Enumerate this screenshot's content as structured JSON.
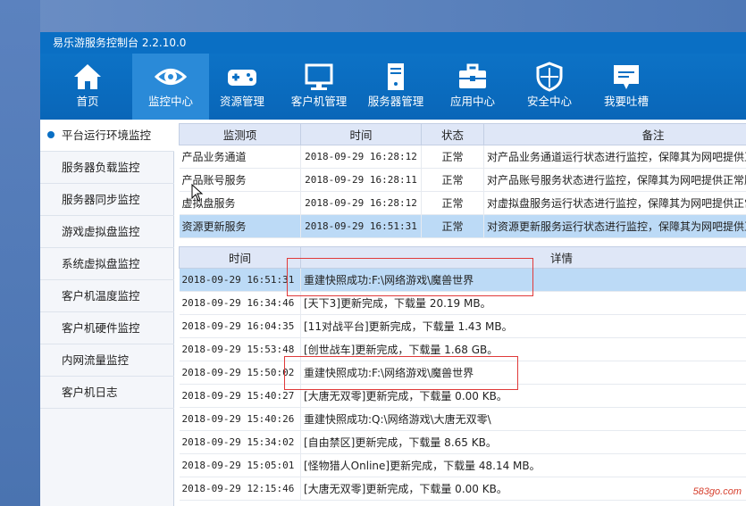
{
  "window": {
    "title": "易乐游服务控制台 2.2.10.0"
  },
  "toolbar": {
    "items": [
      {
        "label": "首页",
        "icon": "home-icon"
      },
      {
        "label": "监控中心",
        "icon": "eye-icon"
      },
      {
        "label": "资源管理",
        "icon": "gamepad-icon"
      },
      {
        "label": "客户机管理",
        "icon": "monitor-icon"
      },
      {
        "label": "服务器管理",
        "icon": "server-icon"
      },
      {
        "label": "应用中心",
        "icon": "toolbox-icon"
      },
      {
        "label": "安全中心",
        "icon": "shield-icon"
      },
      {
        "label": "我要吐槽",
        "icon": "feedback-icon"
      }
    ],
    "active_index": 1
  },
  "sidebar": {
    "items": [
      "平台运行环境监控",
      "服务器负载监控",
      "服务器同步监控",
      "游戏虚拟盘监控",
      "系统虚拟盘监控",
      "客户机温度监控",
      "客户机硬件监控",
      "内网流量监控",
      "客户机日志"
    ]
  },
  "status_table": {
    "headers": [
      "监测项",
      "时间",
      "状态",
      "备注"
    ],
    "rows": [
      [
        "产品业务通道",
        "2018-09-29 16:28:12",
        "正常",
        "对产品业务通道运行状态进行监控，保障其为网吧提供正常服务"
      ],
      [
        "产品账号服务",
        "2018-09-29 16:28:11",
        "正常",
        "对产品账号服务状态进行监控，保障其为网吧提供正常服务"
      ],
      [
        "虚拟盘服务",
        "2018-09-29 16:28:12",
        "正常",
        "对虚拟盘服务运行状态进行监控，保障其为网吧提供正常服务"
      ],
      [
        "资源更新服务",
        "2018-09-29 16:51:31",
        "正常",
        "对资源更新服务运行状态进行监控，保障其为网吧提供正常服务"
      ]
    ]
  },
  "log_table": {
    "headers": [
      "时间",
      "详情"
    ],
    "rows": [
      [
        "2018-09-29 16:51:31",
        "重建快照成功:F:\\网络游戏\\魔兽世界"
      ],
      [
        "2018-09-29 16:34:46",
        "[天下3]更新完成，下载量 20.19 MB。"
      ],
      [
        "2018-09-29 16:04:35",
        "[11对战平台]更新完成，下载量 1.43 MB。"
      ],
      [
        "2018-09-29 15:53:48",
        "[创世战车]更新完成，下载量 1.68 GB。"
      ],
      [
        "2018-09-29 15:50:02",
        "重建快照成功:F:\\网络游戏\\魔兽世界"
      ],
      [
        "2018-09-29 15:40:27",
        "[大唐无双零]更新完成，下载量 0.00 KB。"
      ],
      [
        "2018-09-29 15:40:26",
        "重建快照成功:Q:\\网络游戏\\大唐无双零\\"
      ],
      [
        "2018-09-29 15:34:02",
        "[自由禁区]更新完成，下载量 8.65 KB。"
      ],
      [
        "2018-09-29 15:05:01",
        "[怪物猎人Online]更新完成，下载量 48.14 MB。"
      ],
      [
        "2018-09-29 12:15:46",
        "[大唐无双零]更新完成，下载量 0.00 KB。"
      ]
    ]
  },
  "watermark": "583go.com",
  "colors": {
    "toolbar_bg": "#0a6fc4",
    "active_tool": "#2a8ad8",
    "selected_row": "#bcdaf6",
    "header_bg": "#dfe7f7",
    "highlight_box": "#e03a3a"
  }
}
